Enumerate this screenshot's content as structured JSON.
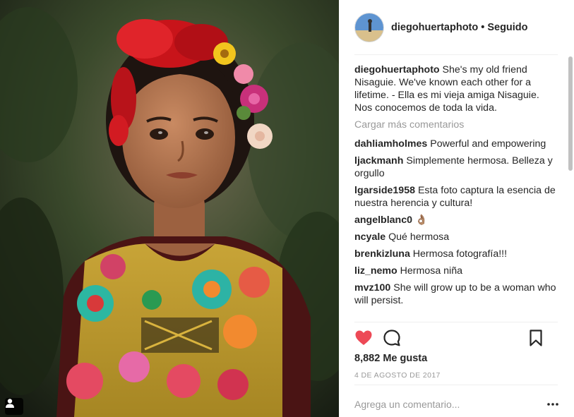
{
  "post": {
    "username": "diegohuertaphoto",
    "separator": "•",
    "follow_status": "Seguido",
    "caption": "She's my old friend Nisaguie. We've known each other for a lifetime. - Ella es mi vieja amiga Nisaguie. Nos conocemos de toda la vida."
  },
  "comments": {
    "load_more": "Cargar más comentarios",
    "items": [
      {
        "user": "dahliamholmes",
        "text": "Powerful and empowering"
      },
      {
        "user": "ljackmanh",
        "text": "Simplemente hermosa. Belleza y orgullo"
      },
      {
        "user": "lgarside1958",
        "text": "Esta foto captura la esencia de nuestra herencia y cultura!"
      },
      {
        "user": "angelblanc0",
        "text": "👌🏽"
      },
      {
        "user": "ncyale",
        "text": "Qué hermosa"
      },
      {
        "user": "brenkizluna",
        "text": "Hermosa fotografía!!!"
      },
      {
        "user": "liz_nemo",
        "text": "Hermosa niña"
      },
      {
        "user": "mvz100",
        "text": "She will grow up to be a woman who will persist."
      }
    ]
  },
  "footer": {
    "likes": "8,882 Me gusta",
    "date": "4 DE AGOSTO DE 2017",
    "comment_placeholder": "Agrega un comentario...",
    "more_glyph": "•••"
  },
  "icons": {
    "heart": "heart-icon",
    "comment": "comment-icon",
    "bookmark": "bookmark-icon",
    "more": "more-options-icon",
    "tag": "user-tag-icon"
  },
  "colors": {
    "like_red": "#ed4956",
    "text": "#262626",
    "muted": "#999999"
  }
}
